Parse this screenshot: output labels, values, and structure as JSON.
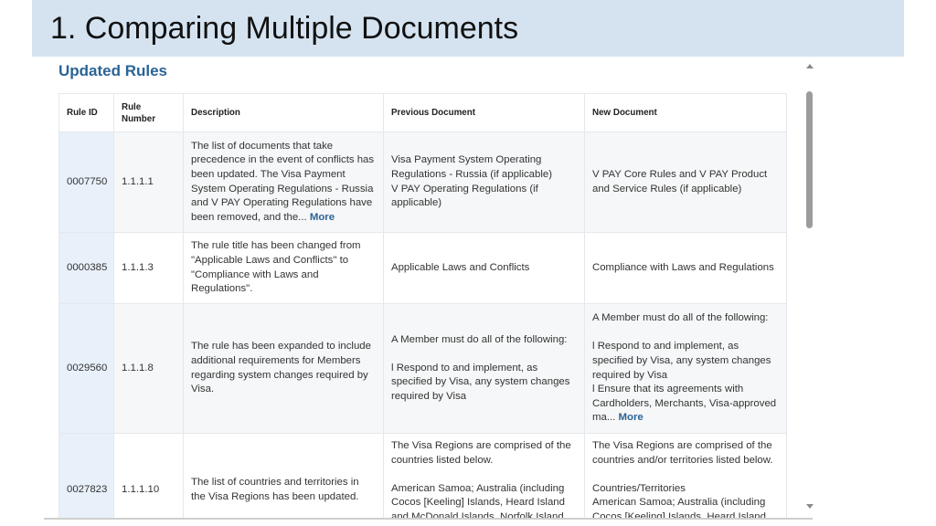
{
  "slide": {
    "title": "1. Comparing Multiple Documents"
  },
  "panel": {
    "section_title": "Updated Rules",
    "columns": [
      "Rule ID",
      "Rule\nNumber",
      "Description",
      "Previous Document",
      "New Document"
    ],
    "rows": [
      {
        "rule_id": "0007750",
        "rule_number": "1.1.1.1",
        "description": "The list of documents that take precedence in the event of conflicts has been updated. The Visa Payment System Operating Regulations - Russia and V PAY Operating Regulations have been removed, and the...",
        "description_more": "More",
        "previous": [
          "Visa Payment System Operating Regulations - Russia (if applicable)",
          "V PAY Operating Regulations (if applicable)"
        ],
        "new": [
          "V PAY Core Rules and V PAY Product and Service Rules (if applicable)"
        ]
      },
      {
        "rule_id": "0000385",
        "rule_number": "1.1.1.3",
        "description": "The rule title has been changed from \"Applicable Laws and Conflicts\" to \"Compliance with Laws and Regulations\".",
        "previous": [
          "Applicable Laws and Conflicts"
        ],
        "new": [
          "Compliance with Laws and Regulations"
        ]
      },
      {
        "rule_id": "0029560",
        "rule_number": "1.1.1.8",
        "description": "The rule has been expanded to include additional requirements for Members regarding system changes required by Visa.",
        "previous": [
          "A Member must do all of the following:",
          "",
          "l Respond to and implement, as specified by Visa, any system changes required by Visa"
        ],
        "new": [
          "A Member must do all of the following:",
          "",
          "l Respond to and implement, as specified by Visa, any system changes required by Visa",
          "l Ensure that its agreements with Cardholders, Merchants, Visa-approved ma..."
        ],
        "new_more": "More"
      },
      {
        "rule_id": "0027823",
        "rule_number": "1.1.1.10",
        "description": "The list of countries and territories in the Visa Regions has been updated.",
        "previous": [
          "The Visa Regions are comprised of the countries listed below.",
          "",
          "American Samoa; Australia (including Cocos [Keeling] Islands, Heard Island and McDonald Islands, Norfolk Island"
        ],
        "new": [
          "The Visa Regions are comprised of the countries and/or territories listed below.",
          "",
          "Countries/Territories",
          "American Samoa; Australia (including Cocos [Keeling] Islands, Heard Island and"
        ]
      }
    ]
  },
  "icons": {
    "scroll_up": "arrow-up-icon",
    "scroll_down": "arrow-down-icon"
  }
}
